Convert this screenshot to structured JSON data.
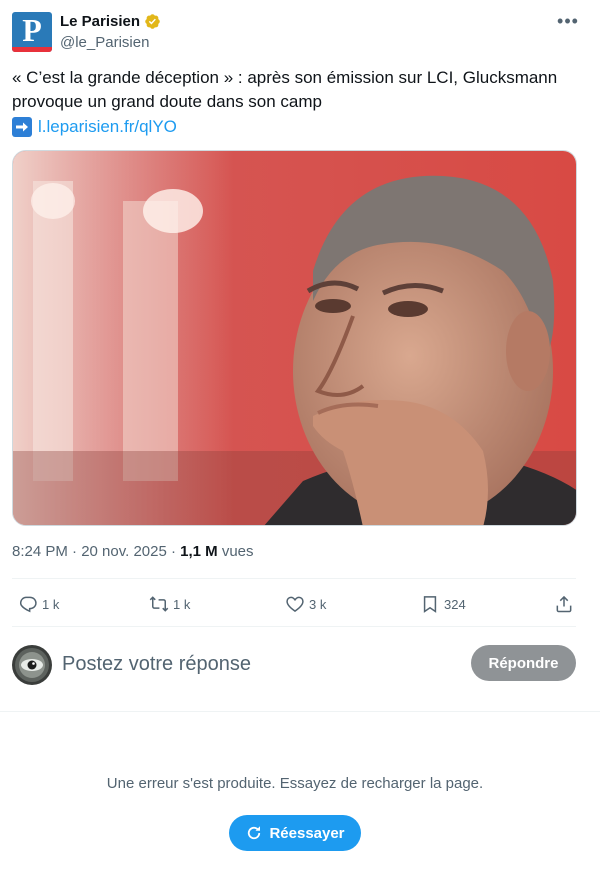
{
  "author": {
    "display_name": "Le Parisien",
    "handle": "@le_Parisien",
    "avatar_letter": "P",
    "verified": true,
    "brand_color": "#2a7ab8",
    "accent_color": "#e8313b"
  },
  "tweet": {
    "text": "« C’est la grande déception » : après son émission sur LCI, Glucksmann provoque un grand doute dans son camp",
    "link_text": "l.leparisien.fr/qlYO",
    "image_description": "photo-man-hand-on-chin-red-background",
    "time": "8:24 PM · 20 nov. 2025 · ",
    "views_count": "1,1 M",
    "views_label": " vues"
  },
  "actions": {
    "replies": "1 k",
    "reposts": "1 k",
    "likes": "3 k",
    "bookmarks": "324"
  },
  "reply_box": {
    "placeholder": "Postez votre réponse",
    "button_label": "Répondre"
  },
  "error": {
    "message": "Une erreur s'est produite. Essayez de recharger la page.",
    "retry_label": "Réessayer"
  },
  "colors": {
    "link": "#1d9bf0",
    "muted": "#536471",
    "text": "#0f1419"
  }
}
